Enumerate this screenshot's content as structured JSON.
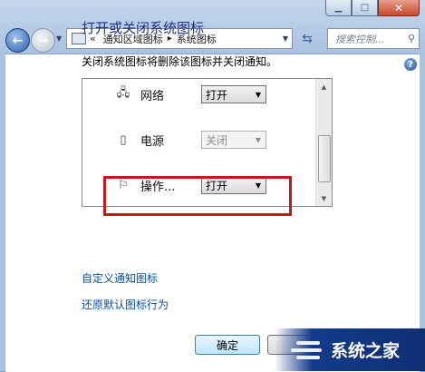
{
  "window": {
    "caption_buttons": [
      "minimize-icon",
      "maximize-icon",
      "close-icon"
    ]
  },
  "address_bar": {
    "overflow": "«",
    "breadcrumbs": [
      "通知区域图标",
      "系统图标"
    ],
    "separator": "▸"
  },
  "search": {
    "placeholder": "搜索控制..."
  },
  "page": {
    "title": "打开或关闭系统图标",
    "description": "关闭系统图标将删除该图标并关闭通知。",
    "rows": [
      {
        "name": "网络",
        "value": "打开",
        "enabled": true,
        "icon": "network-icon"
      },
      {
        "name": "电源",
        "value": "关闭",
        "enabled": false,
        "icon": "power-icon"
      },
      {
        "name": "操作...",
        "value": "打开",
        "enabled": true,
        "icon": "action-center-flag-icon"
      }
    ],
    "links": [
      "自定义通知图标",
      "还原默认图标行为"
    ],
    "ok_label": "确定"
  },
  "watermark": {
    "text": "系统之家"
  },
  "colors": {
    "highlight_border": "#c6171e",
    "link": "#0b4fa3",
    "title": "#1e3287"
  }
}
